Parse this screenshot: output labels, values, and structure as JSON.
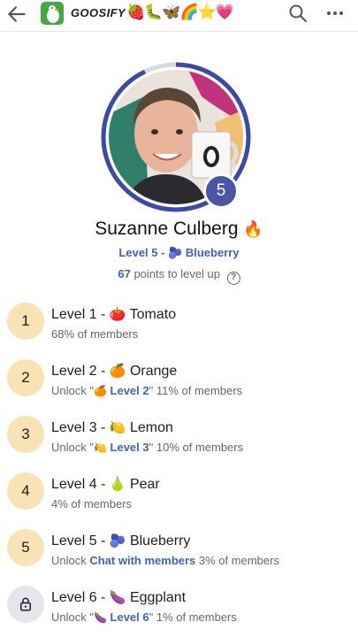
{
  "header": {
    "app_name": "GOOSIFY",
    "emoji_trail": "🍓🐛🦋🌈⭐💗",
    "icons": {
      "back": "arrow-left-icon",
      "logo": "goose-logo-icon",
      "search": "search-icon",
      "more": "more-horizontal-icon"
    }
  },
  "profile": {
    "level_badge": "5",
    "name": "Suzanne Culberg",
    "name_emoji": "🔥",
    "current_level": "Level 5 - 🫐 Blueberry",
    "points_number": "67",
    "points_text": " points to level up",
    "help_icon": "?",
    "ring_color": "#3b4aa8",
    "badge_color": "#4a55a8"
  },
  "levels": [
    {
      "num": "1",
      "title": "Level 1 - ",
      "emoji": "🍅",
      "name": "Tomato",
      "unlock_prefix": "",
      "unlock_link": "",
      "unlock_suffix": "",
      "members": "68% of members",
      "locked": false
    },
    {
      "num": "2",
      "title": "Level 2 - ",
      "emoji": "🍊",
      "name": "Orange",
      "unlock_prefix": "Unlock \"",
      "unlock_emoji": "🍊",
      "unlock_link": " Level 2",
      "unlock_suffix": "\" ",
      "members": "11% of members",
      "locked": false
    },
    {
      "num": "3",
      "title": "Level 3 - ",
      "emoji": "🍋",
      "name": "Lemon",
      "unlock_prefix": "Unlock \"",
      "unlock_emoji": "🍋",
      "unlock_link": " Level 3",
      "unlock_suffix": "\" ",
      "members": "10% of members",
      "locked": false
    },
    {
      "num": "4",
      "title": "Level 4 - ",
      "emoji": "🍐",
      "name": "Pear",
      "unlock_prefix": "",
      "unlock_link": "",
      "unlock_suffix": "",
      "members": "4% of members",
      "locked": false
    },
    {
      "num": "5",
      "title": "Level 5 - ",
      "emoji": "🫐",
      "name": "Blueberry",
      "unlock_prefix": "Unlock ",
      "unlock_emoji": "",
      "unlock_link": "Chat with members",
      "unlock_suffix": " ",
      "members": "3% of members",
      "locked": false
    },
    {
      "num": "",
      "title": "Level 6 - ",
      "emoji": "🍆",
      "name": "Eggplant",
      "unlock_prefix": "Unlock \"",
      "unlock_emoji": "🍆",
      "unlock_link": " Level 6",
      "unlock_suffix": "\" ",
      "members": "1% of members",
      "locked": true,
      "lock_icon": "lock-icon"
    }
  ]
}
